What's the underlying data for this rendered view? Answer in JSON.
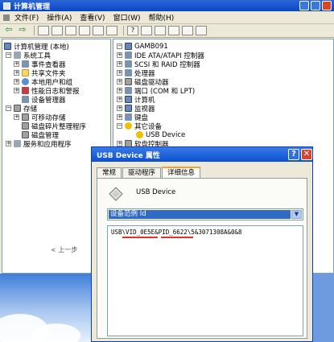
{
  "main_window": {
    "title": "计算机管理",
    "menu": [
      "文件(F)",
      "操作(A)",
      "查看(V)",
      "窗口(W)",
      "帮助(H)"
    ]
  },
  "left_tree": [
    {
      "label": "计算机管理 (本地)",
      "icon": "computer-icon"
    },
    {
      "label": "系统工具",
      "icon": "tools-icon"
    },
    {
      "label": "事件查看器",
      "icon": "event-viewer-icon"
    },
    {
      "label": "共享文件夹",
      "icon": "shared-folder-icon"
    },
    {
      "label": "本地用户和组",
      "icon": "users-icon"
    },
    {
      "label": "性能日志和警报",
      "icon": "perf-log-icon"
    },
    {
      "label": "设备管理器",
      "icon": "device-manager-icon"
    },
    {
      "label": "存储",
      "icon": "storage-icon"
    },
    {
      "label": "可移动存储",
      "icon": "removable-storage-icon"
    },
    {
      "label": "磁盘碎片整理程序",
      "icon": "defrag-icon"
    },
    {
      "label": "磁盘管理",
      "icon": "disk-management-icon"
    },
    {
      "label": "服务和应用程序",
      "icon": "services-icon"
    }
  ],
  "right_tree": [
    {
      "label": "GAMB091",
      "icon": "computer-icon"
    },
    {
      "label": "IDE ATA/ATAPI 控制器",
      "icon": "ide-icon"
    },
    {
      "label": "SCSI 和 RAID 控制器",
      "icon": "scsi-icon"
    },
    {
      "label": "处理器",
      "icon": "cpu-icon"
    },
    {
      "label": "磁盘驱动器",
      "icon": "disk-icon"
    },
    {
      "label": "端口 (COM 和 LPT)",
      "icon": "port-icon"
    },
    {
      "label": "计算机",
      "icon": "computer-icon"
    },
    {
      "label": "监视器",
      "icon": "monitor-icon"
    },
    {
      "label": "键盘",
      "icon": "keyboard-icon"
    },
    {
      "label": "其它设备",
      "icon": "other-devices-icon"
    },
    {
      "label": "USB Device",
      "icon": "warning-icon"
    },
    {
      "label": "软盘控制器",
      "icon": "floppy-icon"
    }
  ],
  "left_bottom": {
    "prev": "< 上一步"
  },
  "dialog": {
    "title": "USB Device 属性",
    "tabs": [
      "常规",
      "驱动程序",
      "详细信息"
    ],
    "active_tab": "详细信息",
    "device_name": "USB Device",
    "property_selected": "设备范例 Id",
    "value": "USB\\VID_0E5E&PID_6622\\5&3071308A&0&8",
    "highlight": [
      "VID_0E5E",
      "PID_6622"
    ],
    "underline_color": "#e03030"
  }
}
